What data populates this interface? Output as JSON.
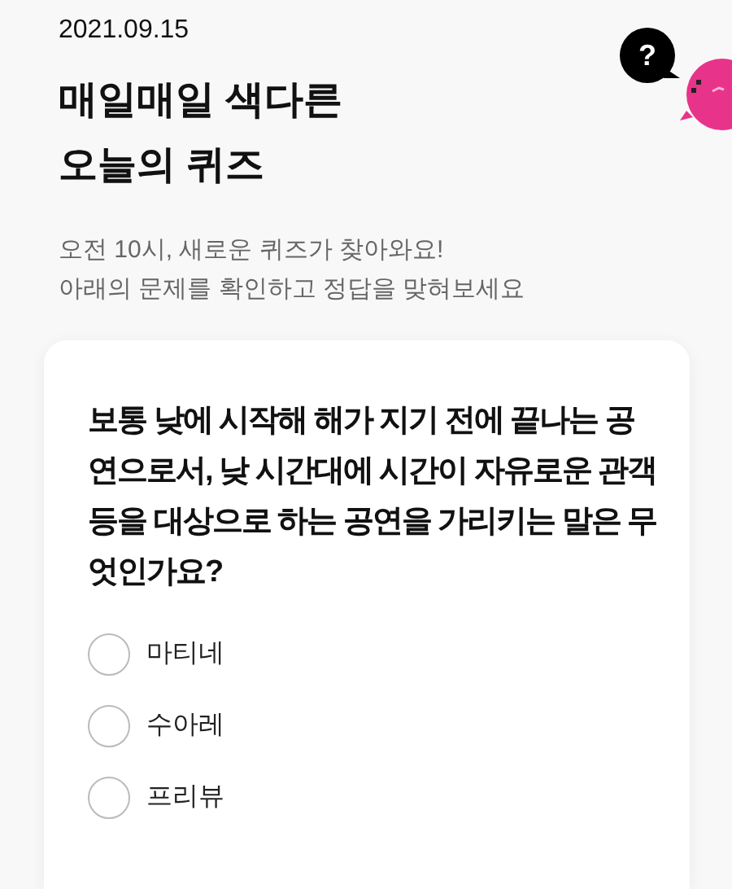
{
  "date": "2021.09.15",
  "title_lines": [
    "매일매일 색다른",
    "오늘의 퀴즈"
  ],
  "subtitle_lines": [
    "오전 10시, 새로운 퀴즈가 찾아와요!",
    "아래의 문제를 확인하고 정답을 맞혀보세요"
  ],
  "help_bubble": {
    "label": "?"
  },
  "question": "보통 낮에 시작해 해가 지기 전에 끝나는 공연으로서, 낮 시간대에 시간이 자유로운 관객 등을 대상으로 하는 공연을 가리키는 말은 무엇인가요?",
  "options": [
    {
      "label": "마티네",
      "selected": false
    },
    {
      "label": "수아레",
      "selected": false
    },
    {
      "label": "프리뷰",
      "selected": false
    }
  ]
}
